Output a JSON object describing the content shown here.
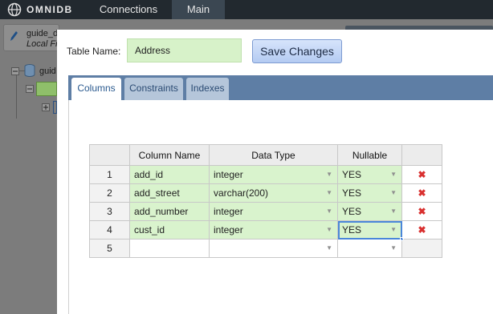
{
  "app": {
    "logo_text": "OMNIDB",
    "nav": {
      "connections": "Connections",
      "main": "Main"
    }
  },
  "background": {
    "connection": {
      "title": "guide_d",
      "subtitle": "Local Fi"
    },
    "tree": {
      "root_label": "guid"
    }
  },
  "modal": {
    "table_name_label": "Table Name:",
    "table_name_value": "Address",
    "save_button": "Save Changes",
    "tabs": [
      {
        "label": "Columns",
        "active": true
      },
      {
        "label": "Constraints",
        "active": false
      },
      {
        "label": "Indexes",
        "active": false
      }
    ],
    "grid": {
      "headers": [
        "Column Name",
        "Data Type",
        "Nullable"
      ],
      "rows": [
        {
          "num": "1",
          "name": "add_id",
          "type": "integer",
          "nullable": "YES"
        },
        {
          "num": "2",
          "name": "add_street",
          "type": "varchar(200)",
          "nullable": "YES"
        },
        {
          "num": "3",
          "name": "add_number",
          "type": "integer",
          "nullable": "YES"
        },
        {
          "num": "4",
          "name": "cust_id",
          "type": "integer",
          "nullable": "YES"
        },
        {
          "num": "5",
          "name": "",
          "type": "",
          "nullable": ""
        }
      ],
      "delete_icon": "delete-x-icon"
    }
  },
  "colors": {
    "topbar": "#22292f",
    "tab_strip": "#5e7ea5",
    "edited_cell": "#d9f3cd",
    "delete": "#d9302f",
    "selection": "#4a86d9"
  }
}
